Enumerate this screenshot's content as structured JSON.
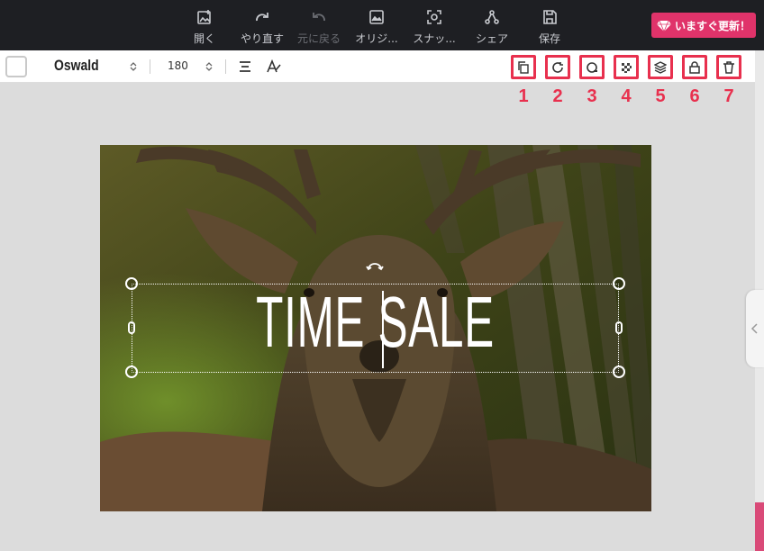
{
  "toolbar": {
    "items": [
      {
        "label": "開く",
        "icon": "open-image-icon",
        "enabled": true
      },
      {
        "label": "やり直す",
        "icon": "redo-icon",
        "enabled": true
      },
      {
        "label": "元に戻る",
        "icon": "undo-icon",
        "enabled": false
      },
      {
        "label": "オリジ...",
        "icon": "original-image-icon",
        "enabled": true
      },
      {
        "label": "スナッ...",
        "icon": "snapshot-icon",
        "enabled": true
      },
      {
        "label": "シェア",
        "icon": "share-icon",
        "enabled": true
      },
      {
        "label": "保存",
        "icon": "save-icon",
        "enabled": true
      }
    ],
    "upgrade_label": "いますぐ更新！"
  },
  "text_tools": {
    "font": "Oswald",
    "size": "180",
    "actions": [
      {
        "number": "1",
        "icon": "duplicate-icon"
      },
      {
        "number": "2",
        "icon": "rotate-icon"
      },
      {
        "number": "3",
        "icon": "shape-icon"
      },
      {
        "number": "4",
        "icon": "transparency-icon"
      },
      {
        "number": "5",
        "icon": "layers-icon"
      },
      {
        "number": "6",
        "icon": "lock-icon"
      },
      {
        "number": "7",
        "icon": "delete-icon"
      }
    ]
  },
  "canvas": {
    "text": "TIME SALE"
  },
  "colors": {
    "topbar": "#1e1f23",
    "accent": "#e0336a",
    "callout": "#e8304e"
  }
}
